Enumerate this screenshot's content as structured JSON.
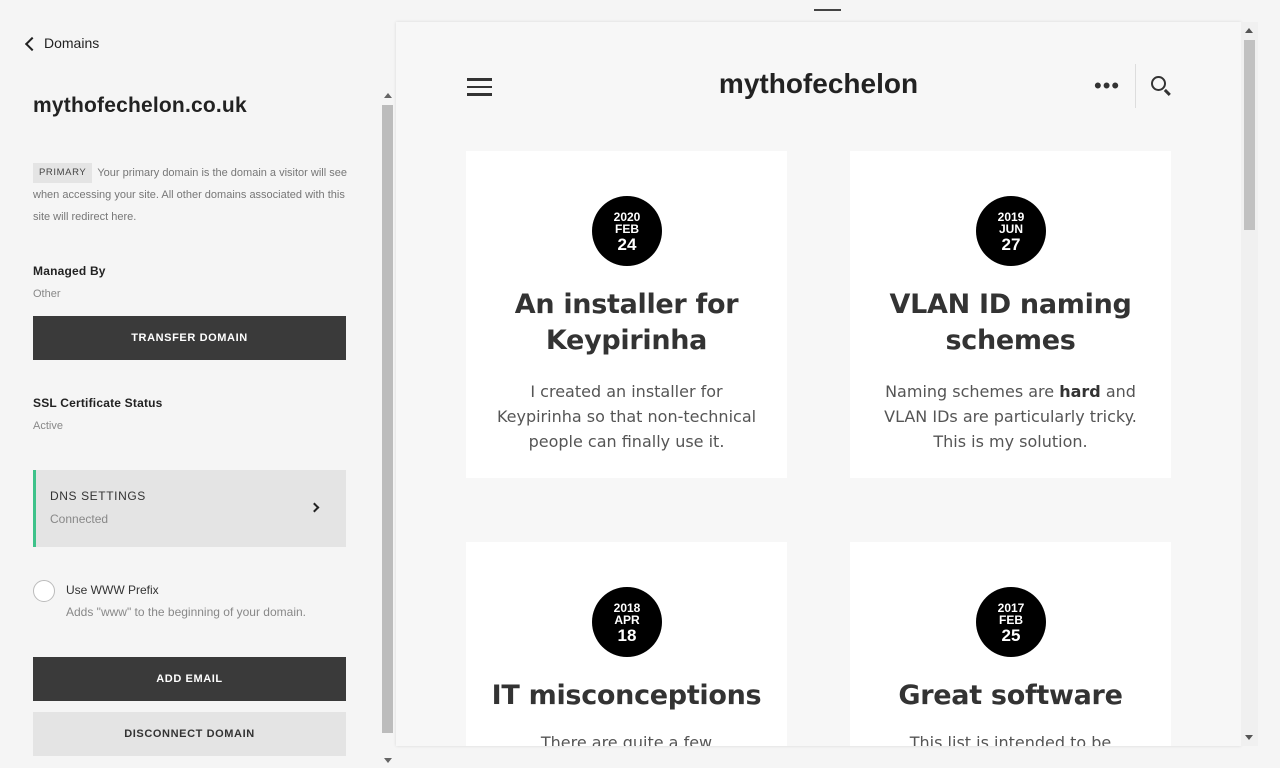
{
  "panel": {
    "back_label": "Domains",
    "domain_title": "mythofechelon.co.uk",
    "primary_badge": "PRIMARY",
    "primary_note": "Your primary domain is the domain a visitor will see when accessing your site. All other domains associated with this site will redirect here.",
    "managed_by_label": "Managed By",
    "managed_by_value": "Other",
    "transfer_button": "TRANSFER DOMAIN",
    "ssl_label": "SSL Certificate Status",
    "ssl_value": "Active",
    "dns_title": "DNS SETTINGS",
    "dns_status": "Connected",
    "www_label": "Use WWW Prefix",
    "www_desc": "Adds \"www\" to the beginning of your domain.",
    "www_checked": false,
    "add_email_button": "ADD EMAIL",
    "disconnect_button": "DISCONNECT DOMAIN",
    "accent_color": "#3ec28a"
  },
  "site": {
    "title": "mythofechelon",
    "menu_icon": "hamburger-menu-icon",
    "more_icon": "more-dots-icon",
    "search_icon": "search-icon",
    "posts": [
      {
        "year": "2020",
        "month": "FEB",
        "day": "24",
        "title": "An installer for Keypirinha",
        "excerpt_before": "I created an installer for Keypirinha so that non-technical people can finally use it.",
        "excerpt_bold": "",
        "excerpt_after": ""
      },
      {
        "year": "2019",
        "month": "JUN",
        "day": "27",
        "title": "VLAN ID naming schemes",
        "excerpt_before": "Naming schemes are ",
        "excerpt_bold": "hard",
        "excerpt_after": " and VLAN IDs are particularly tricky. This is my solution."
      },
      {
        "year": "2018",
        "month": "APR",
        "day": "18",
        "title": "IT misconceptions",
        "excerpt_before": "There are quite a few",
        "excerpt_bold": "",
        "excerpt_after": ""
      },
      {
        "year": "2017",
        "month": "FEB",
        "day": "25",
        "title": "Great software",
        "excerpt_before": "This list is intended to be everything",
        "excerpt_bold": "",
        "excerpt_after": ""
      }
    ]
  }
}
